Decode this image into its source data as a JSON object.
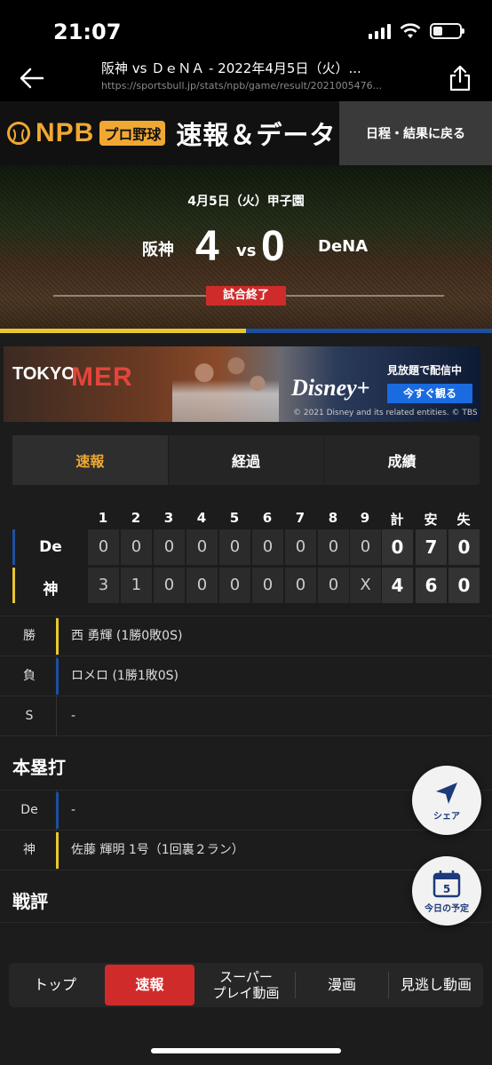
{
  "status": {
    "time": "21:07"
  },
  "nav": {
    "title": "阪神 vs ＤｅＮＡ - 2022年4月5日（火）...",
    "url": "https://sportsbull.jp/stats/npb/game/result/2021005476..."
  },
  "brand": {
    "npb": "NPB",
    "pro": "プロ野球",
    "title": "速報＆データ",
    "schedule_link": "日程・結果に戻る"
  },
  "game": {
    "date_venue": "4月5日（火）甲子園",
    "home_team": "阪神",
    "home_score": "4",
    "vs": "vs",
    "away_score": "0",
    "away_team": "DeNA",
    "status": "試合終了"
  },
  "ad": {
    "tokyo": "TOKYO",
    "mer": "MER",
    "disney": "Disney+",
    "watch": "見放題で配信中",
    "cta": "今すぐ観る",
    "copyright": "© 2021 Disney and its related entities. © TBS"
  },
  "tabs": [
    "速報",
    "経過",
    "成績"
  ],
  "scoreboard": {
    "headers": [
      "1",
      "2",
      "3",
      "4",
      "5",
      "6",
      "7",
      "8",
      "9",
      "計",
      "安",
      "失"
    ],
    "rows": [
      {
        "team": "De",
        "color": "#1d4fa0",
        "innings": [
          "0",
          "0",
          "0",
          "0",
          "0",
          "0",
          "0",
          "0",
          "0"
        ],
        "totals": [
          "0",
          "7",
          "0"
        ]
      },
      {
        "team": "神",
        "color": "#e8c632",
        "innings": [
          "3",
          "1",
          "0",
          "0",
          "0",
          "0",
          "0",
          "0",
          "X"
        ],
        "totals": [
          "4",
          "6",
          "0"
        ]
      }
    ]
  },
  "pitchers": [
    {
      "label": "勝",
      "value": "西 勇輝 (1勝0敗0S)",
      "color": "#e8c632"
    },
    {
      "label": "負",
      "value": "ロメロ (1勝1敗0S)",
      "color": "#1d4fa0"
    },
    {
      "label": "S",
      "value": "-",
      "color": ""
    }
  ],
  "homerun": {
    "title": "本塁打",
    "rows": [
      {
        "label": "De",
        "value": "-",
        "color": "#1d4fa0"
      },
      {
        "label": "神",
        "value": "佐藤 輝明 1号（1回裏２ラン）",
        "color": "#e8c632"
      }
    ]
  },
  "review": {
    "title": "戦評"
  },
  "fab": {
    "share": "シェア",
    "calendar_day": "5",
    "today": "今日の予定"
  },
  "bottom_nav": [
    "トップ",
    "速報",
    "スーパー\nプレイ動画",
    "漫画",
    "見逃し動画"
  ]
}
